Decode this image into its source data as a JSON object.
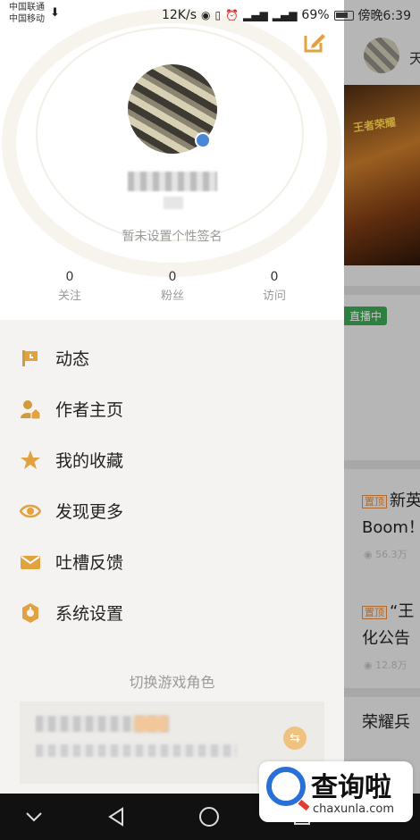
{
  "status_bar": {
    "carrier1": "中国联通",
    "carrier2": "中国移动",
    "speed": "12K/s",
    "battery": "69%",
    "time": "傍晚6:39"
  },
  "background_page": {
    "banner_text": "王者荣耀",
    "live_badge": "直播中",
    "item1_tag": "置顶",
    "item1_line1": "新英",
    "item1_line2": "Boom！",
    "item1_meta": "56.3万",
    "item2_tag": "置顶",
    "item2_line1": "“王",
    "item2_line2": "化公告",
    "item2_meta": "12.8万",
    "item3_line1": "荣耀兵"
  },
  "profile": {
    "signature": "暂未设置个性签名",
    "stats": [
      {
        "value": "0",
        "label": "关注"
      },
      {
        "value": "0",
        "label": "粉丝"
      },
      {
        "value": "0",
        "label": "访问"
      }
    ]
  },
  "menu": [
    {
      "label": "动态",
      "icon": "flag-icon"
    },
    {
      "label": "作者主页",
      "icon": "author-home-icon"
    },
    {
      "label": "我的收藏",
      "icon": "star-icon"
    },
    {
      "label": "发现更多",
      "icon": "eye-icon"
    },
    {
      "label": "吐槽反馈",
      "icon": "envelope-icon"
    },
    {
      "label": "系统设置",
      "icon": "settings-icon"
    }
  ],
  "switch_role": {
    "title": "切换游戏角色"
  },
  "accent_color": "#e2a23f",
  "watermark": {
    "cn": "查询啦",
    "en": "chaxunla.com"
  }
}
